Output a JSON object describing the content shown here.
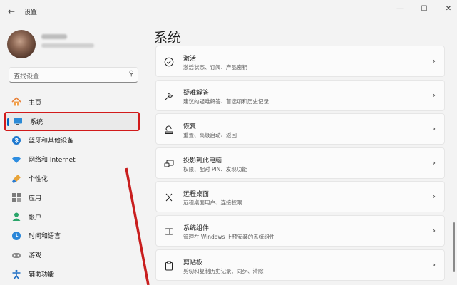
{
  "titlebar": {
    "back": "←",
    "title": "设置",
    "minimize": "—",
    "maximize": "☐",
    "close": "✕"
  },
  "search": {
    "placeholder": "查找设置",
    "icon": "⚲"
  },
  "nav": {
    "items": [
      {
        "label": "主页",
        "icon": "home-icon"
      },
      {
        "label": "系统",
        "icon": "monitor-icon",
        "selected": true
      },
      {
        "label": "蓝牙和其他设备",
        "icon": "bluetooth-icon"
      },
      {
        "label": "网络和 Internet",
        "icon": "wifi-icon"
      },
      {
        "label": "个性化",
        "icon": "brush-icon"
      },
      {
        "label": "应用",
        "icon": "apps-icon"
      },
      {
        "label": "帐户",
        "icon": "person-icon"
      },
      {
        "label": "时间和语言",
        "icon": "globe-clock-icon"
      },
      {
        "label": "游戏",
        "icon": "gamepad-icon"
      },
      {
        "label": "辅助功能",
        "icon": "accessibility-icon"
      }
    ]
  },
  "main": {
    "title": "系统",
    "cards": [
      {
        "title": "激活",
        "desc": "激活状态、订阅、产品密钥",
        "icon": "check-circle-icon"
      },
      {
        "title": "疑难解答",
        "desc": "建议的疑难解答、首选项和历史记录",
        "icon": "wrench-icon"
      },
      {
        "title": "恢复",
        "desc": "重置、高级启动、返回",
        "icon": "recovery-icon"
      },
      {
        "title": "投影到此电脑",
        "desc": "权限、配对 PIN、发现功能",
        "icon": "project-icon"
      },
      {
        "title": "远程桌面",
        "desc": "远程桌面用户、连接权限",
        "icon": "remote-desktop-icon"
      },
      {
        "title": "系统组件",
        "desc": "管理在 Windows 上预安装的系统组件",
        "icon": "components-icon"
      },
      {
        "title": "剪贴板",
        "desc": "剪切和复制历史记录、同步、清除",
        "icon": "clipboard-icon"
      }
    ],
    "chevron": "›"
  },
  "colors": {
    "accent": "#0067c0",
    "highlight_border": "#d11a1a",
    "arrow": "#c81e1e"
  }
}
